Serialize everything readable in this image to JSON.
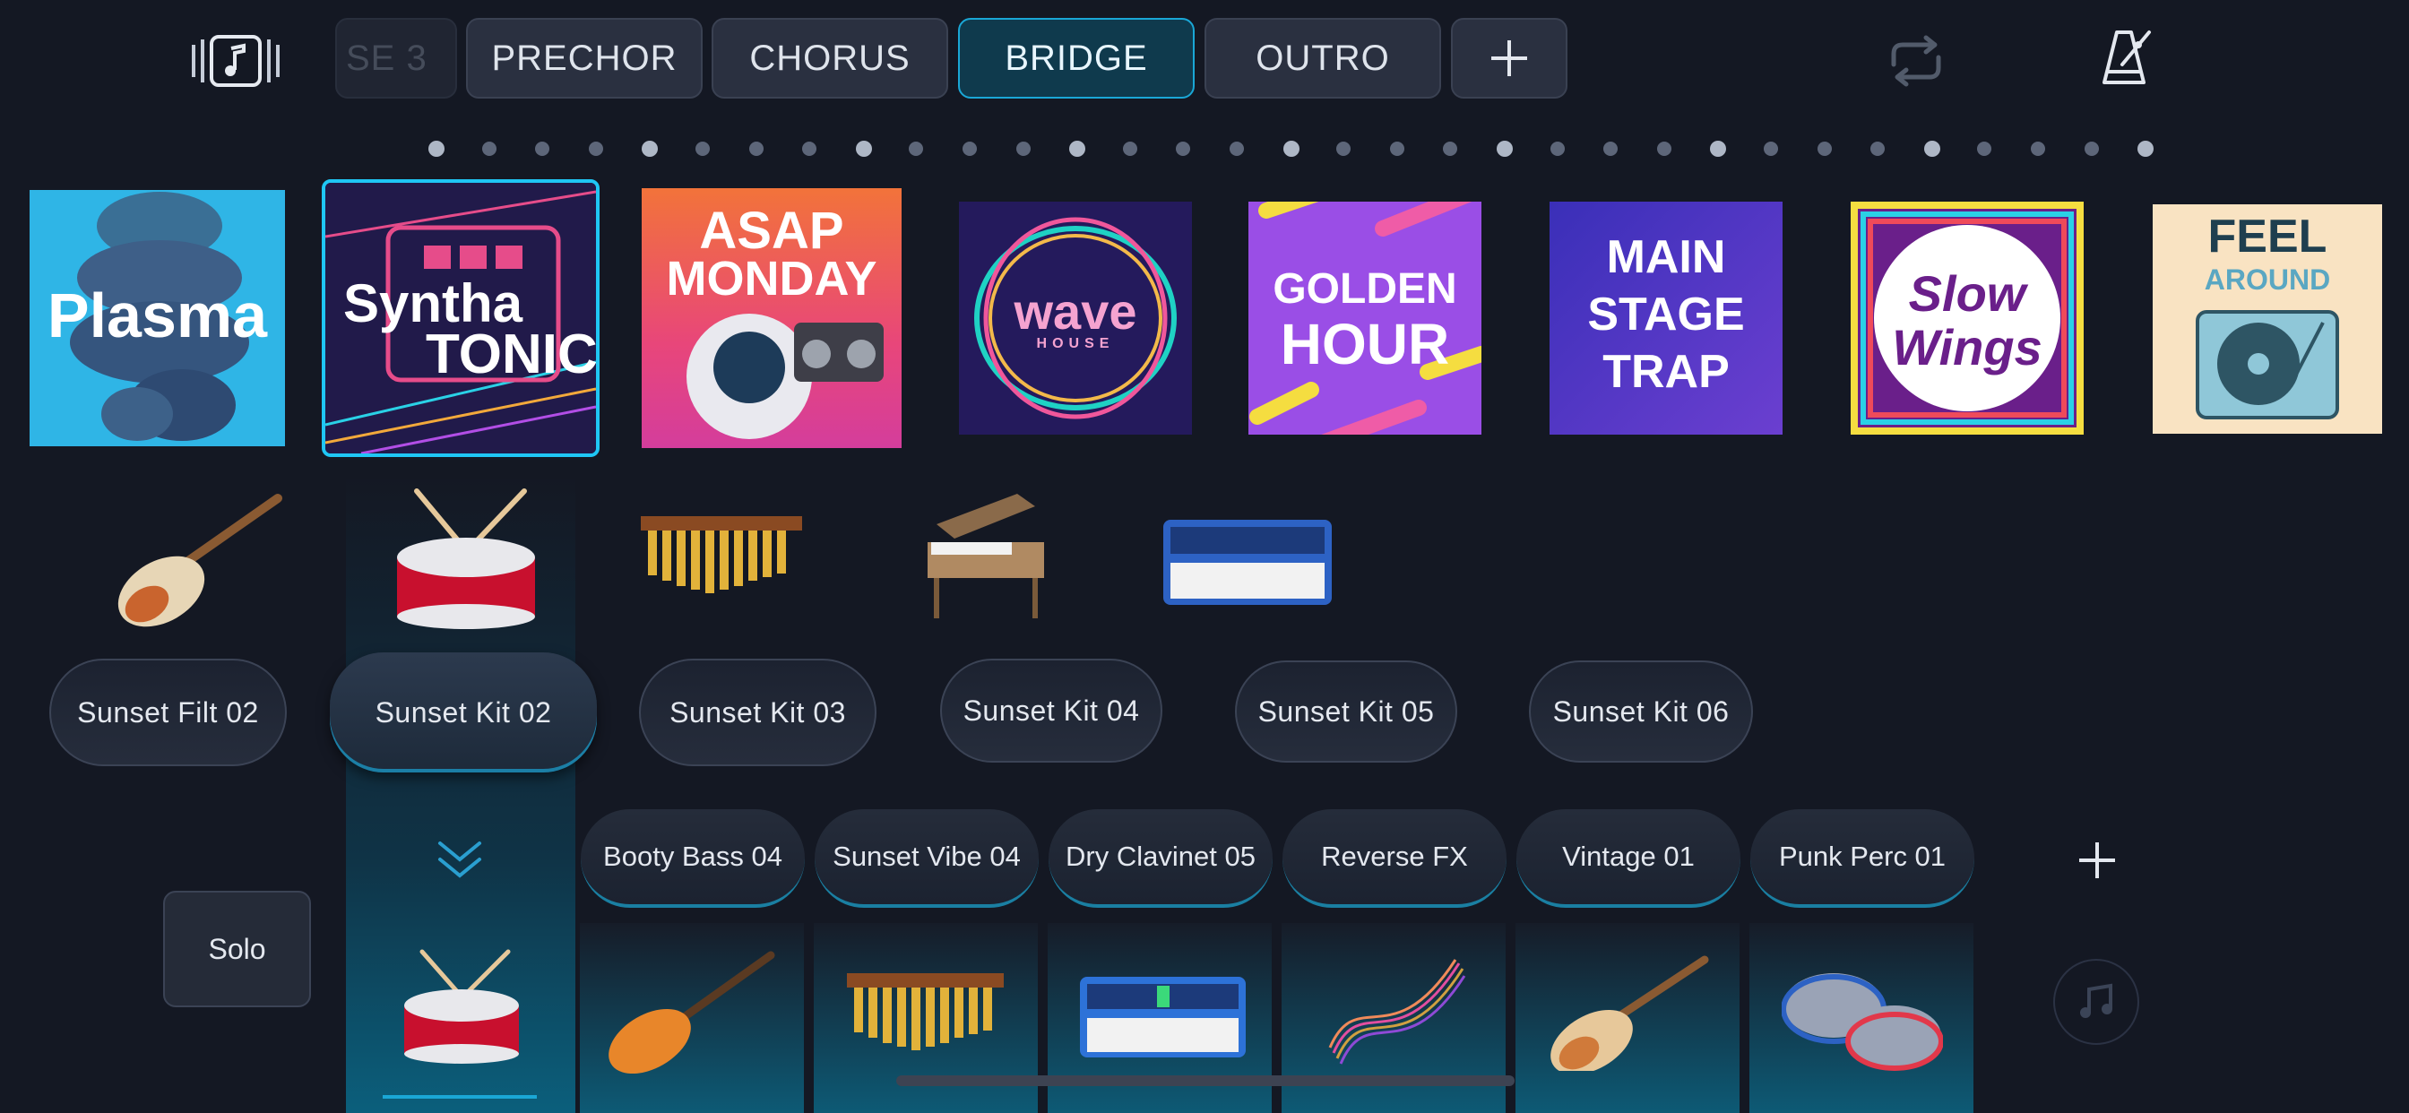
{
  "header": {
    "section_tabs": [
      {
        "label": "SE 3",
        "active": false,
        "faded": true
      },
      {
        "label": "PRECHOR",
        "active": false
      },
      {
        "label": "CHORUS",
        "active": false
      },
      {
        "label": "BRIDGE",
        "active": true
      },
      {
        "label": "OUTRO",
        "active": false
      }
    ],
    "add_section_icon": "plus-icon",
    "loop_icon": "loop-icon",
    "metronome_icon": "metronome-icon",
    "song_icon": "music-note-icon"
  },
  "page_indicator": {
    "total": 33,
    "accent_every": 4
  },
  "sound_packs": [
    {
      "name": "Plasma"
    },
    {
      "name_line1": "Syntha",
      "name_line2": "TONIC",
      "selected": true
    },
    {
      "name_line1": "ASAP",
      "name_line2": "MONDAY"
    },
    {
      "name": "wave",
      "sub": "HOUSE"
    },
    {
      "name_line1": "GOLDEN",
      "name_line2": "HOUR"
    },
    {
      "name_line1": "MAIN",
      "name_line2": "STAGE",
      "name_line3": "TRAP"
    },
    {
      "name_line1": "Slow",
      "name_line2": "Wings"
    },
    {
      "name_line1": "FEEL",
      "name_line2": "AROUND"
    }
  ],
  "instruments": [
    "electric-guitar-icon",
    "snare-drum-icon",
    "marimba-icon",
    "grand-piano-icon",
    "synth-keyboard-icon"
  ],
  "presets": [
    {
      "label": "Sunset Filt 02",
      "selected": false
    },
    {
      "label": "Sunset Kit 02",
      "selected": true
    },
    {
      "label": "Sunset Kit 03",
      "selected": false
    },
    {
      "label": "Sunset Kit 04",
      "selected": false
    },
    {
      "label": "Sunset Kit 05",
      "selected": false
    },
    {
      "label": "Sunset Kit 06",
      "selected": false
    }
  ],
  "solo_label": "Solo",
  "tracks": [
    {
      "label": "Booty Bass 04",
      "icon": "bass-guitar-icon"
    },
    {
      "label": "Sunset Vibe 04",
      "icon": "marimba-icon"
    },
    {
      "label": "Dry Clavinet 05",
      "icon": "synth-keyboard-icon"
    },
    {
      "label": "Reverse FX",
      "icon": "waveform-fx-icon"
    },
    {
      "label": "Vintage 01",
      "icon": "electric-guitar-icon"
    },
    {
      "label": "Punk Perc 01",
      "icon": "steel-pan-icon"
    }
  ],
  "add_track_icon": "plus-icon",
  "colors": {
    "accent": "#1aa7d6",
    "background": "#141823"
  }
}
